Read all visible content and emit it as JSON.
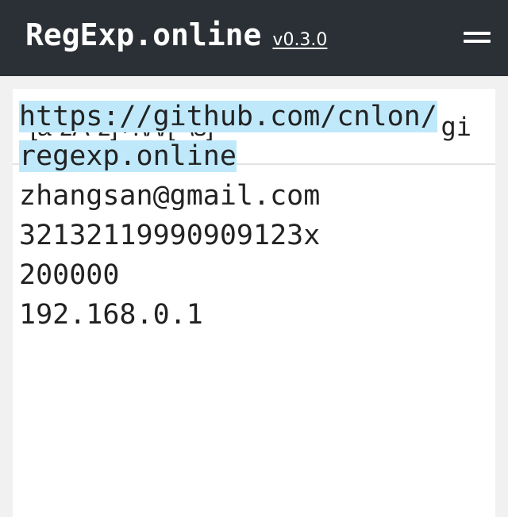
{
  "header": {
    "brand": "RegExp.online",
    "version": "v0.3.0",
    "menu_icon": "hamburger-menu-icon",
    "background": "#2b3036"
  },
  "regex": {
    "pattern": "[a-zA-z]+:\\/\\/[^\\s]*",
    "flags": "gi"
  },
  "test_text": {
    "match_color": "#bfe9fb",
    "match": {
      "line1": "https://github.com/cnlon/",
      "line2": "regexp.online"
    },
    "lines": [
      "zhangsan@gmail.com",
      "32132119990909123x",
      "200000",
      "192.168.0.1"
    ]
  }
}
